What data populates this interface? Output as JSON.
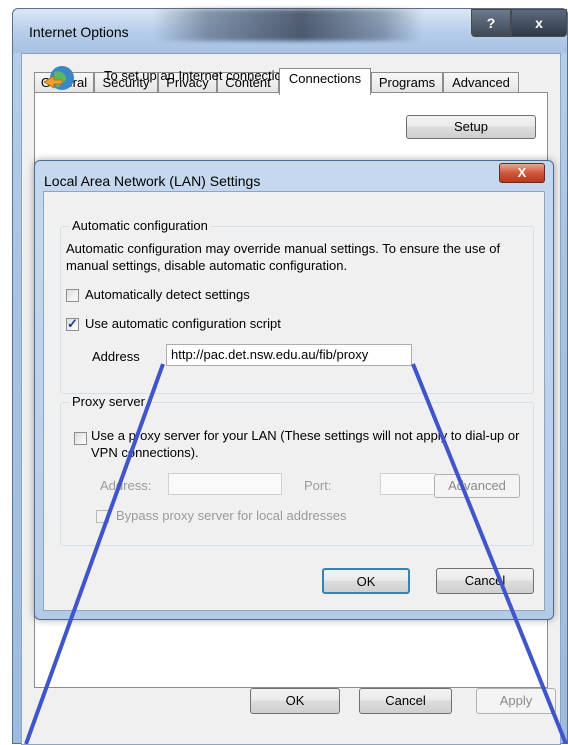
{
  "outer": {
    "title": "Internet Options",
    "help_label": "?",
    "close_label": "x",
    "tabs": [
      {
        "label": "General"
      },
      {
        "label": "Security"
      },
      {
        "label": "Privacy"
      },
      {
        "label": "Content"
      },
      {
        "label": "Connections"
      },
      {
        "label": "Programs"
      },
      {
        "label": "Advanced"
      }
    ],
    "setup_text": "To set up an Internet connection, click Setup.",
    "setup_button": "Setup",
    "ok_button": "OK",
    "cancel_button": "Cancel",
    "apply_button": "Apply"
  },
  "lan": {
    "title": "Local Area Network (LAN) Settings",
    "close_label": "X",
    "auto_config": {
      "legend": "Automatic configuration",
      "description": "Automatic configuration may override manual settings.  To ensure the use of manual settings, disable automatic configuration.",
      "detect_label": "Automatically detect settings",
      "detect_checked": false,
      "script_label": "Use automatic configuration script",
      "script_checked": true,
      "address_label": "Address",
      "address_value": "http://pac.det.nsw.edu.au/fib/proxy"
    },
    "proxy": {
      "legend": "Proxy server",
      "use_proxy_label": "Use a proxy server for your LAN (These settings will not apply to dial-up or VPN connections).",
      "use_proxy_checked": false,
      "address_label": "Address:",
      "port_label": "Port:",
      "advanced_button": "Advanced",
      "bypass_label": "Bypass proxy server for local addresses"
    },
    "ok_button": "OK",
    "cancel_button": "Cancel"
  },
  "colors": {
    "annotation_line": "#3f55c9",
    "window_frame": "#b4cbe7",
    "close_red": "#c8452a"
  }
}
